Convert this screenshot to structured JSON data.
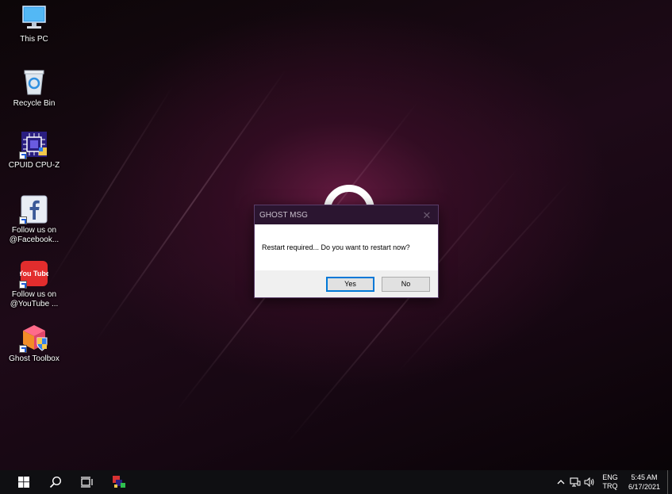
{
  "desktop_icons": [
    {
      "id": "this-pc",
      "label": "This PC"
    },
    {
      "id": "recycle-bin",
      "label": "Recycle Bin"
    },
    {
      "id": "cpuz",
      "label": "CPUID CPU-Z"
    },
    {
      "id": "facebook",
      "label": "Follow us on @Facebook..."
    },
    {
      "id": "youtube",
      "label": "Follow us on @YouTube ..."
    },
    {
      "id": "ghost-toolbox",
      "label": "Ghost Toolbox"
    }
  ],
  "youtube_icon_text": "You Tube",
  "dialog": {
    "title": "GHOST MSG",
    "close_glyph": "✕",
    "message": "Restart required... Do you want to restart now?",
    "yes_label": "Yes",
    "no_label": "No"
  },
  "taskbar": {
    "language_top": "ENG",
    "language_bottom": "TRQ",
    "time": "5:45 AM",
    "date": "6/17/2021"
  },
  "colors": {
    "dialog_titlebar": "#2b1530",
    "default_button_border": "#0078d7",
    "taskbar": "#0f0f12"
  }
}
